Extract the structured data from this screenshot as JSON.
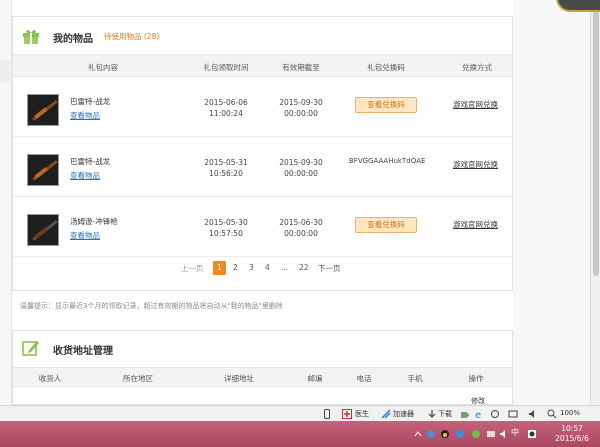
{
  "items_section": {
    "title": "我的物品",
    "pending": "待使用物品 (28)",
    "columns": [
      "礼包内容",
      "礼包领取时间",
      "有效期截至",
      "礼包兑换码",
      "兑换方式"
    ],
    "rows": [
      {
        "name": "巴雷特-战龙",
        "view": "查看物品",
        "claim_date": "2015-06-06",
        "claim_time": "11:00:24",
        "expire_date": "2015-09-30",
        "expire_time": "00:00:00",
        "code_button": "查看兑换码",
        "code_text": "",
        "exchange": "游戏官网兑换"
      },
      {
        "name": "巴雷特-战龙",
        "view": "查看物品",
        "claim_date": "2015-05-31",
        "claim_time": "10:56:20",
        "expire_date": "2015-09-30",
        "expire_time": "00:00:00",
        "code_button": "",
        "code_text": "BFVGGAAAHukTdQAE",
        "exchange": "游戏官网兑换"
      },
      {
        "name": "汤姆逊-冲锋枪",
        "view": "查看物品",
        "claim_date": "2015-05-30",
        "claim_time": "10:57:50",
        "expire_date": "2015-06-30",
        "expire_time": "00:00:00",
        "code_button": "查看兑换码",
        "code_text": "",
        "exchange": "游戏官网兑换"
      }
    ],
    "pager": {
      "prev": "上一页",
      "current": "1",
      "p2": "2",
      "p3": "3",
      "p4": "4",
      "ellipsis": "...",
      "last": "22",
      "next": "下一页"
    }
  },
  "tip": "温馨提示：显示最近3个月的领取记录，超过有效期的物品将自动从\"我的物品\"里删除",
  "address_section": {
    "title": "收货地址管理",
    "columns": [
      "收货人",
      "所在地区",
      "详细地址",
      "邮编",
      "电话",
      "手机",
      "操作"
    ],
    "op_sub": "修改"
  },
  "statusbar": {
    "doctor": "医生",
    "accelerator": "加速器",
    "download": "下载",
    "zoom": "100%"
  },
  "taskbar": {
    "ime": "中",
    "time": "10:57",
    "date": "2015/6/6"
  },
  "colors": {
    "accent_orange": "#f08a1f",
    "link_blue": "#2a6fb8",
    "gift_green": "#8bc34a",
    "taskbar_pink": "#b9536c"
  }
}
